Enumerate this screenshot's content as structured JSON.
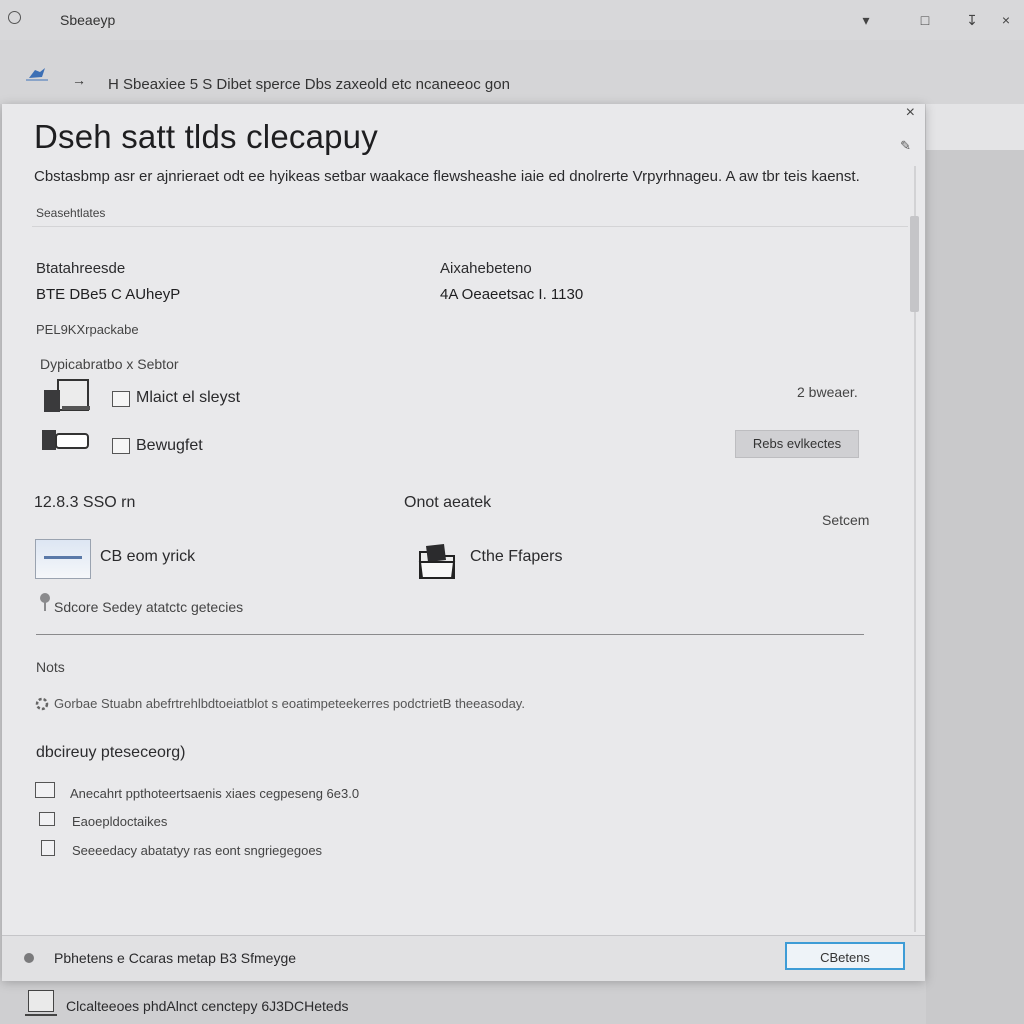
{
  "window": {
    "title": "Sbeaeyp",
    "controls": [
      "▾",
      "□",
      "↧",
      "×"
    ]
  },
  "address": {
    "arrow": "→",
    "path": "H Sbeaxiee 5 S Dibet  sperce Dbs  zaxeold etc   ncaneeoc gon"
  },
  "dialog": {
    "close": "×",
    "pen": "✎",
    "title": "Dseh satt tlds clecapuy",
    "description": "Cbstasbmp asr er ajnrieraet odt ee hyikeas setbar waakace flewsheashe iaie ed dnolrerte Vrpyrhnageu. A aw tbr teis kaenst.",
    "section_label": "Seasehtlates",
    "left_label": "Btatahreesde",
    "left_value": "BTE DBe5 C AUheyP",
    "right_label": "Aixahebeteno",
    "right_value": "4A Oeaeetsac I. 1130",
    "small_heading": "PEL9KXrpackabe",
    "group_heading": "Dypicabratbo x  Sebtor",
    "item1_label": "Mlaict el sleyst",
    "item2_label": "Bewugfet",
    "right_count": "2 bweaer.",
    "grey_button": "Rebs evlkectes",
    "size_label": "12.8.3 SSO rn",
    "storage_label": "Onot aeatek",
    "option_label": "Setcem",
    "thumb_item_label": "CB eom yrick",
    "folder_item_label": "Cthe Ffapers",
    "pin_text": "Sdcore  Sedey atatctc getecies",
    "notes_heading": "Nots",
    "notes_text": "Gorbae Stuabn abefrtrehlbdtoeiatblot s  eoatimpeteekerres  podctrietB theeasoday.",
    "extras_heading": "dbcireuy pteseceorg)",
    "list": [
      "Anecahrt ppthoteertsaenis xiaes cegpeseng 6e3.0",
      "Eaoepldoctaikes",
      "Seeeedacy abatatyy ras eont sngriegegoes"
    ]
  },
  "footer": {
    "text": "Pbhetens e Ccaras metap B3 Sfmeyge",
    "button": "CBetens"
  },
  "statusbar": {
    "text": "Clcalteeoes phdAlnct cenctepy 6J3DCHeteds"
  }
}
